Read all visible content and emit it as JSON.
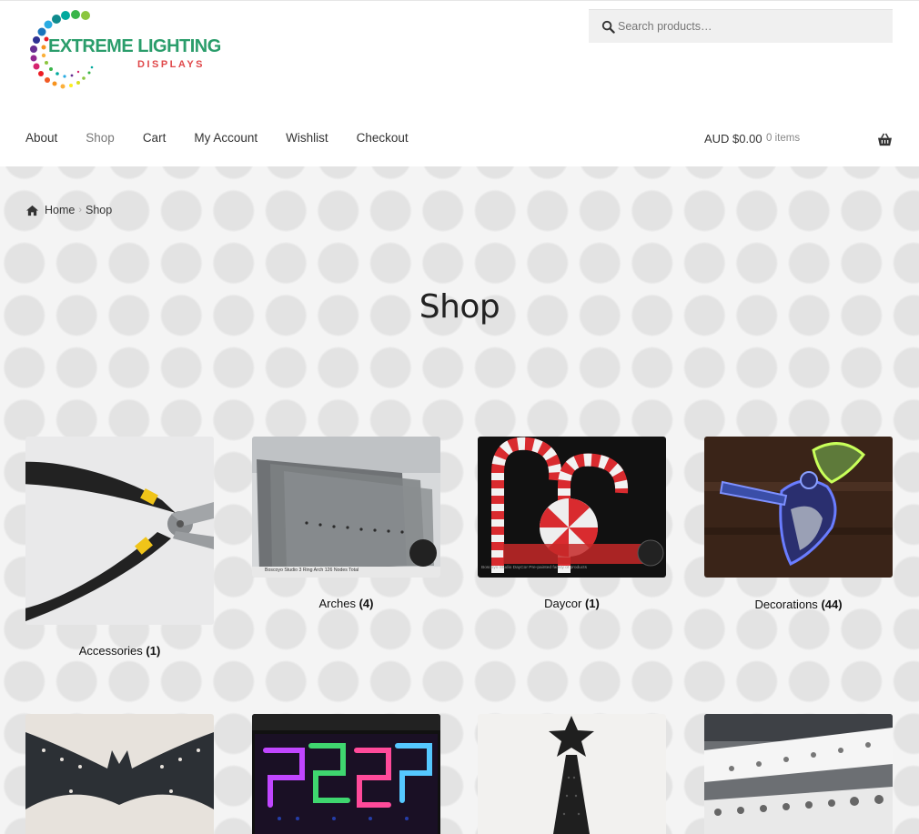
{
  "logo": {
    "line1": "EXTREME LIGHTING",
    "line2": "DISPLAYS"
  },
  "search": {
    "placeholder": "Search products…"
  },
  "nav": {
    "items": [
      {
        "label": "About"
      },
      {
        "label": "Shop",
        "current": true
      },
      {
        "label": "Cart"
      },
      {
        "label": "My Account"
      },
      {
        "label": "Wishlist"
      },
      {
        "label": "Checkout"
      }
    ]
  },
  "cart": {
    "amount": "AUD $0.00",
    "count": "0 items"
  },
  "breadcrumb": {
    "home": "Home",
    "current": "Shop"
  },
  "page": {
    "title": "Shop"
  },
  "categories": [
    {
      "name": "Accessories",
      "count": "(1)",
      "image_text": ""
    },
    {
      "name": "Arches",
      "count": "(4)",
      "image_text": "Boscoyo Studio 3 Ring Arch 126 Nodes Total"
    },
    {
      "name": "Daycor",
      "count": "(1)",
      "image_text": "Boscoyo Studio DayCor Pre-painted family of products"
    },
    {
      "name": "Decorations",
      "count": "(44)",
      "image_text": ""
    },
    {
      "name": "",
      "count": ""
    },
    {
      "name": "",
      "count": ""
    },
    {
      "name": "",
      "count": ""
    },
    {
      "name": "",
      "count": ""
    }
  ],
  "colors": {
    "logo_green": "#2a9d6b",
    "logo_red": "#e0484a",
    "pattern_circle": "#e3e3e3"
  }
}
